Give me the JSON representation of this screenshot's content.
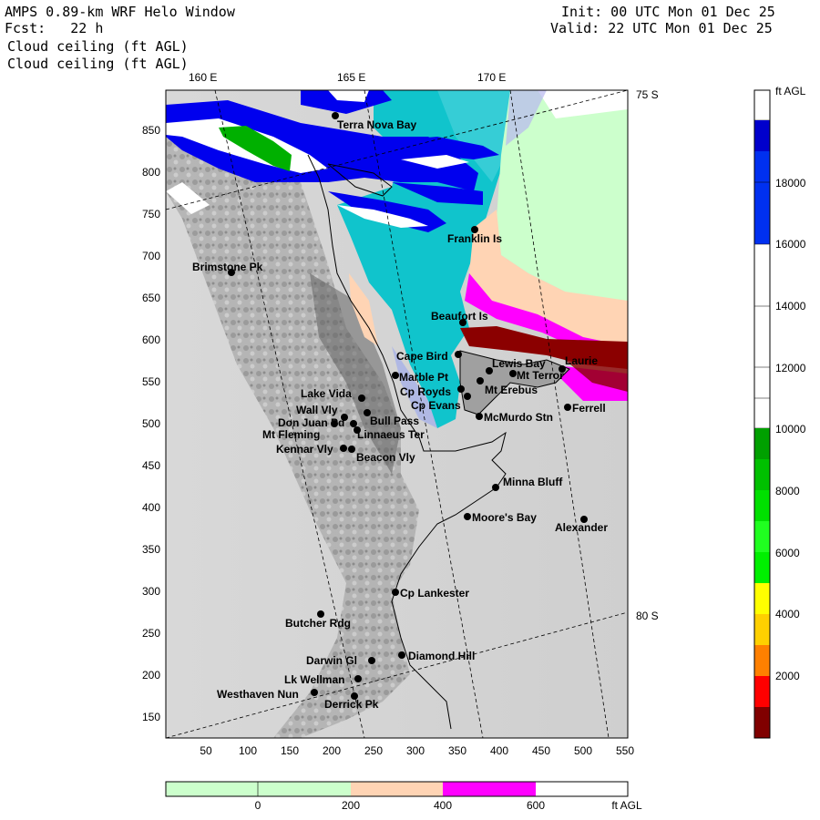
{
  "header": {
    "title": "AMPS 0.89-km WRF Helo Window",
    "fcst": "Fcst:   22 h",
    "field_line1": "Cloud ceiling (ft AGL)",
    "field_line2": "Cloud ceiling (ft AGL)",
    "init": "Init: 00 UTC Mon 01 Dec 25",
    "valid": "Valid: 22 UTC Mon 01 Dec 25"
  },
  "map": {
    "lon_labels": [
      "160 E",
      "165 E",
      "170 E"
    ],
    "lat_labels": [
      "75 S",
      "80 S"
    ],
    "x_ticks": [
      "50",
      "100",
      "150",
      "200",
      "250",
      "300",
      "350",
      "400",
      "450",
      "500",
      "550"
    ],
    "y_ticks": [
      "850",
      "800",
      "750",
      "700",
      "650",
      "600",
      "550",
      "500",
      "450",
      "400",
      "350",
      "300",
      "250",
      "200",
      "150"
    ],
    "stations": [
      {
        "name": "Terra Nova Bay"
      },
      {
        "name": "Brimstone Pk"
      },
      {
        "name": "Franklin Is"
      },
      {
        "name": "Beaufort Is"
      },
      {
        "name": "Cape Bird"
      },
      {
        "name": "Lewis Bay"
      },
      {
        "name": "Laurie"
      },
      {
        "name": "Mt Terror"
      },
      {
        "name": "Marble Pt"
      },
      {
        "name": "Cp Royds"
      },
      {
        "name": "Mt Erebus"
      },
      {
        "name": "Cp Evans"
      },
      {
        "name": "Lake Vida"
      },
      {
        "name": "Wall Vly"
      },
      {
        "name": "Bull Pass"
      },
      {
        "name": "Don Juan Pd"
      },
      {
        "name": "Mt Fleming"
      },
      {
        "name": "Linnaeus Ter"
      },
      {
        "name": "McMurdo Stn"
      },
      {
        "name": "Ferrell"
      },
      {
        "name": "Kennar Vly"
      },
      {
        "name": "Beacon Vly"
      },
      {
        "name": "Minna Bluff"
      },
      {
        "name": "Moore's Bay"
      },
      {
        "name": "Alexander"
      },
      {
        "name": "Cp Lankester"
      },
      {
        "name": "Butcher Rdg"
      },
      {
        "name": "Darwin Gl"
      },
      {
        "name": "Diamond Hill"
      },
      {
        "name": "Lk Wellman"
      },
      {
        "name": "Westhaven Nun"
      },
      {
        "name": "Derrick Pk"
      }
    ]
  },
  "colorbar_right": {
    "unit": "ft AGL",
    "labels": [
      "18000",
      "16000",
      "14000",
      "12000",
      "10000",
      "8000",
      "6000",
      "4000",
      "2000"
    ],
    "colors": [
      "#ffffff",
      "#0000cc",
      "#0020e0",
      "#0030f0",
      "#0040ff",
      "#ffffff",
      "#ffffff",
      "#ffffff",
      "#ffffff",
      "#ffffff",
      "#ffffff",
      "#00a000",
      "#00c000",
      "#00e000",
      "#20ff20",
      "#ffff00",
      "#ffd000",
      "#ff8000",
      "#ff0000",
      "#c00000",
      "#800000"
    ]
  },
  "colorbar_bottom": {
    "unit": "ft AGL",
    "labels": [
      "0",
      "200",
      "400",
      "600"
    ],
    "colors": [
      "#ccffcc",
      "#ccffcc",
      "#ffd4b4",
      "#ff00ff",
      "#ffffff"
    ]
  }
}
